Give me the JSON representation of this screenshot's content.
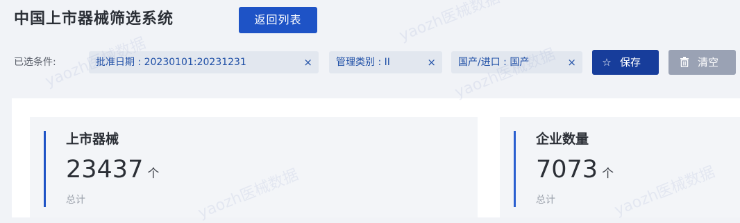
{
  "header": {
    "title": "中国上市器械筛选系统",
    "back_button_label": "返回列表"
  },
  "filters": {
    "label": "已选条件:",
    "chips": [
      {
        "text": "批准日期 : 20230101:20231231",
        "close_icon": "×"
      },
      {
        "text": "管理类别 : II",
        "close_icon": "×"
      },
      {
        "text": "国产/进口 : 国产",
        "close_icon": "×"
      }
    ],
    "save_button": {
      "icon": "☆",
      "icon_name": "star-icon",
      "label": "保存"
    },
    "clear_button": {
      "icon": "🗑",
      "icon_name": "trash-icon",
      "label": "清空"
    }
  },
  "cards": [
    {
      "label": "上市器械",
      "value": "23437",
      "unit": "个",
      "sub": "总计"
    },
    {
      "label": "企业数量",
      "value": "7073",
      "unit": "个",
      "sub": "总计"
    }
  ],
  "watermark": "yaozh医械数据",
  "colors": {
    "accent": "#1e53c6",
    "save": "#173d9b",
    "clear": "#9aa2b4",
    "chip_bg": "#e2e7ef",
    "chip_text": "#1f4fa6"
  }
}
